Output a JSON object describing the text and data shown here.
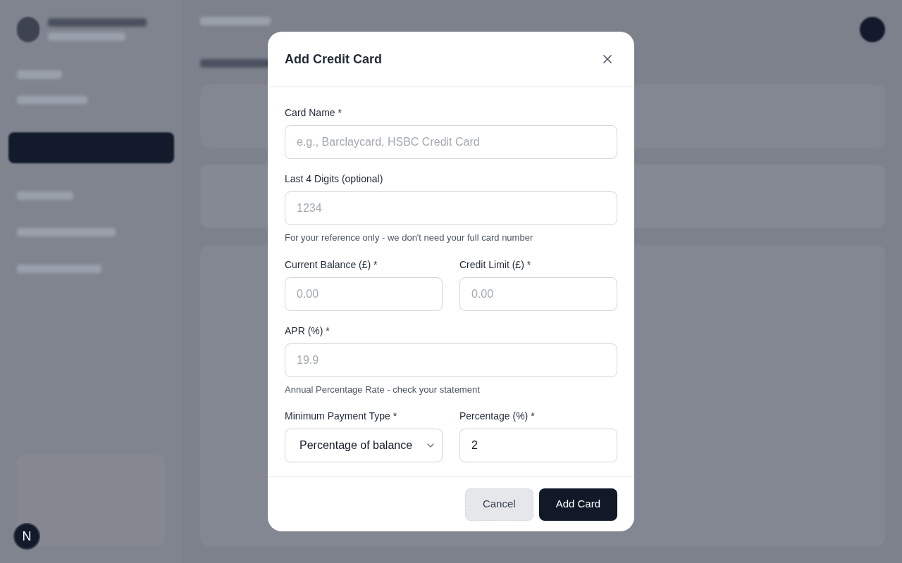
{
  "floating_badge": "N",
  "dialog": {
    "title": "Add Credit Card",
    "rows": [
      [
        {
          "kind": "text",
          "label": "Card Name *",
          "placeholder": "e.g., Barclaycard, HSBC Credit Card"
        }
      ],
      [
        {
          "kind": "text",
          "label": "Last 4 Digits (optional)",
          "placeholder": "1234",
          "hint": "For your reference only - we don't need your full card number"
        }
      ],
      [
        {
          "kind": "text",
          "label": "Current Balance (£) *",
          "placeholder": "0.00"
        },
        {
          "kind": "text",
          "label": "Credit Limit (£) *",
          "placeholder": "0.00"
        }
      ],
      [
        {
          "kind": "text",
          "label": "APR (%) *",
          "placeholder": "19.9",
          "hint": "Annual Percentage Rate - check your statement"
        }
      ],
      [
        {
          "kind": "select",
          "label": "Minimum Payment Type *",
          "value": "Percentage of balance"
        },
        {
          "kind": "text",
          "label": "Percentage (%) *",
          "value": "2"
        }
      ]
    ],
    "buttons": [
      {
        "kind": "secondary",
        "label": "Cancel"
      },
      {
        "kind": "primary",
        "label": "Add Card"
      }
    ]
  }
}
